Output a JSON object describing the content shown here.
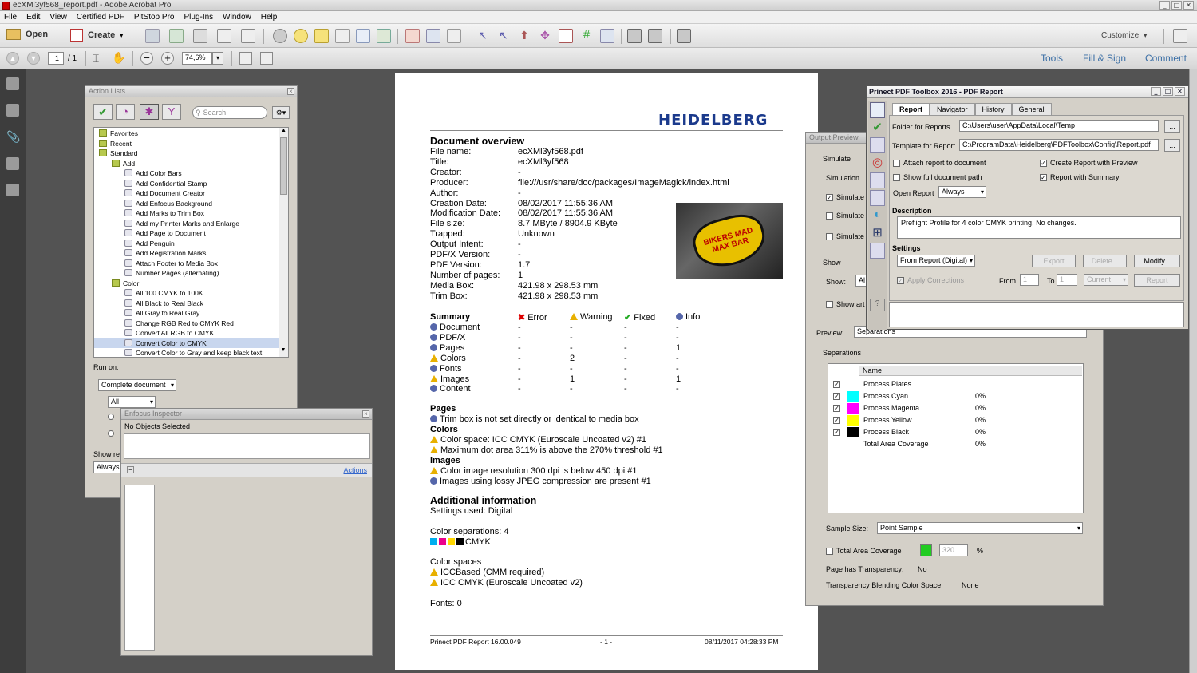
{
  "window": {
    "title": "ecXMl3yf568_report.pdf - Adobe Acrobat Pro"
  },
  "menu": [
    "File",
    "Edit",
    "View",
    "Certified PDF",
    "PitStop Pro",
    "Plug-Ins",
    "Window",
    "Help"
  ],
  "toolbar": {
    "open": "Open",
    "create": "Create",
    "customize": "Customize"
  },
  "nav": {
    "page": "1",
    "pages": "/ 1",
    "zoom": "74,6%",
    "tools": "Tools",
    "fill_sign": "Fill & Sign",
    "comment": "Comment"
  },
  "action_lists": {
    "title": "Action Lists",
    "search_placeholder": "Search",
    "tree": [
      {
        "label": "Favorites",
        "level": 0
      },
      {
        "label": "Recent",
        "level": 0
      },
      {
        "label": "Standard",
        "level": 0
      },
      {
        "label": "Add",
        "level": 1
      },
      {
        "label": "Add Color Bars",
        "level": 2
      },
      {
        "label": "Add Confidential Stamp",
        "level": 2
      },
      {
        "label": "Add Document Creator",
        "level": 2
      },
      {
        "label": "Add Enfocus Background",
        "level": 2
      },
      {
        "label": "Add Marks to Trim Box",
        "level": 2
      },
      {
        "label": "Add my Printer Marks and Enlarge",
        "level": 2
      },
      {
        "label": "Add Page to Document",
        "level": 2
      },
      {
        "label": "Add Penguin",
        "level": 2
      },
      {
        "label": "Add Registration Marks",
        "level": 2
      },
      {
        "label": "Attach Footer to Media Box",
        "level": 2
      },
      {
        "label": "Number Pages  (alternating)",
        "level": 2
      },
      {
        "label": "Color",
        "level": 1
      },
      {
        "label": "All 100 CMYK to 100K",
        "level": 2
      },
      {
        "label": "All Black to Real Black",
        "level": 2
      },
      {
        "label": "All Gray to Real Gray",
        "level": 2
      },
      {
        "label": "Change RGB Red to CMYK Red",
        "level": 2
      },
      {
        "label": "Convert All RGB to CMYK",
        "level": 2
      },
      {
        "label": "Convert Color to CMYK",
        "level": 2
      },
      {
        "label": "Convert Color to Gray and keep black text",
        "level": 2
      }
    ],
    "run_on": "Run on:",
    "run_on_value": "Complete document",
    "all_value": "All",
    "show_res": "Show res",
    "always": "Always"
  },
  "enfocus": {
    "title": "Enfocus Inspector",
    "no_objects": "No Objects Selected",
    "actions": "Actions"
  },
  "report": {
    "logo": "HEIDELBERG",
    "overview_title": "Document overview",
    "fields": [
      {
        "k": "File name:",
        "v": "ecXMl3yf568.pdf"
      },
      {
        "k": "Title:",
        "v": "ecXMl3yf568"
      },
      {
        "k": "Creator:",
        "v": "-"
      },
      {
        "k": "Producer:",
        "v": "file:///usr/share/doc/packages/ImageMagick/index.html"
      },
      {
        "k": "Author:",
        "v": "-"
      },
      {
        "k": "Creation Date:",
        "v": "08/02/2017 11:55:36 AM"
      },
      {
        "k": "Modification Date:",
        "v": "08/02/2017 11:55:36 AM"
      },
      {
        "k": "File size:",
        "v": "8.7 MByte / 8904.9 KByte"
      },
      {
        "k": "Trapped:",
        "v": "Unknown"
      },
      {
        "k": "Output Intent:",
        "v": "-"
      },
      {
        "k": "PDF/X Version:",
        "v": "-"
      },
      {
        "k": "PDF Version:",
        "v": "1.7"
      },
      {
        "k": "Number of pages:",
        "v": "1"
      },
      {
        "k": "Media Box:",
        "v": "421.98 x 298.53 mm"
      },
      {
        "k": "Trim Box:",
        "v": "421.98 x 298.53 mm"
      }
    ],
    "image_text": "BIKERS MAD MAX BAR",
    "summary": {
      "title": "Summary",
      "cols": [
        "Error",
        "Warning",
        "Fixed",
        "Info"
      ],
      "rows": [
        {
          "name": "Document",
          "icon": "info",
          "vals": [
            "-",
            "-",
            "-",
            "-"
          ]
        },
        {
          "name": "PDF/X",
          "icon": "info",
          "vals": [
            "-",
            "-",
            "-",
            "-"
          ]
        },
        {
          "name": "Pages",
          "icon": "info",
          "vals": [
            "-",
            "-",
            "-",
            "1"
          ]
        },
        {
          "name": "Colors",
          "icon": "warn",
          "vals": [
            "-",
            "2",
            "-",
            "-"
          ]
        },
        {
          "name": "Fonts",
          "icon": "info",
          "vals": [
            "-",
            "-",
            "-",
            "-"
          ]
        },
        {
          "name": "Images",
          "icon": "warn",
          "vals": [
            "-",
            "1",
            "-",
            "1"
          ]
        },
        {
          "name": "Content",
          "icon": "info",
          "vals": [
            "-",
            "-",
            "-",
            "-"
          ]
        }
      ]
    },
    "sections": [
      {
        "h": "Pages",
        "items": [
          {
            "icon": "info",
            "t": "Trim box is not set directly or identical to media box"
          }
        ]
      },
      {
        "h": "Colors",
        "items": [
          {
            "icon": "warn",
            "t": "Color space: ICC CMYK (Euroscale Uncoated v2) #1"
          },
          {
            "icon": "warn",
            "t": "Maximum dot area 311% is above the 270% threshold #1"
          }
        ]
      },
      {
        "h": "Images",
        "items": [
          {
            "icon": "warn",
            "t": "Color image resolution 300 dpi is below 450 dpi #1"
          },
          {
            "icon": "info",
            "t": "Images using lossy JPEG compression are present #1"
          }
        ]
      }
    ],
    "additional_title": "Additional information",
    "settings_used": "Settings used: Digital",
    "color_separations": "Color separations: 4",
    "cmyk": "CMYK",
    "color_spaces": "Color spaces",
    "cs_items": [
      "ICCBased (CMM required)",
      "ICC CMYK (Euroscale Uncoated v2)"
    ],
    "fonts": "Fonts: 0",
    "footer_left": "Prinect PDF Report 16.00.049",
    "footer_mid": "- 1 -",
    "footer_right": "08/11/2017 04:28:33 PM"
  },
  "output_preview": {
    "title": "Output Preview",
    "simulate": "Simulate",
    "simulation": "Simulation",
    "simulate_cb": "Simulate",
    "show": "Show",
    "show_label": "Show:",
    "show_value": "Al",
    "show_art": "Show art",
    "preview_label": "Preview:",
    "preview_value": "Separations",
    "separations": "Separations",
    "name_col": "Name",
    "seps": [
      {
        "name": "Process Plates",
        "color": "",
        "pct": ""
      },
      {
        "name": "Process Cyan",
        "color": "#00ffff",
        "pct": "0%"
      },
      {
        "name": "Process Magenta",
        "color": "#ff00ff",
        "pct": "0%"
      },
      {
        "name": "Process Yellow",
        "color": "#ffff00",
        "pct": "0%"
      },
      {
        "name": "Process Black",
        "color": "#000000",
        "pct": "0%"
      },
      {
        "name": "Total Area Coverage",
        "color": "",
        "pct": "0%"
      }
    ],
    "sample_size": "Sample Size:",
    "sample_value": "Point Sample",
    "tac": "Total Area Coverage",
    "tac_value": "320",
    "pct": "%",
    "transparency": "Page has Transparency:",
    "transparency_value": "No",
    "blending": "Transparency Blending Color Space:",
    "blending_value": "None"
  },
  "prinect": {
    "title": "Prinect PDF Toolbox 2016 - PDF Report",
    "tabs": [
      "Report",
      "Navigator",
      "History",
      "General"
    ],
    "folder_label": "Folder for Reports",
    "folder_value": "C:\\Users\\user\\AppData\\Local\\Temp",
    "template_label": "Template for Report",
    "template_value": "C:\\ProgramData\\Heidelberg\\PDFToolbox\\Config\\Report.pdf",
    "attach": "Attach report to document",
    "create_preview": "Create Report with Preview",
    "show_path": "Show full document path",
    "with_summary": "Report with Summary",
    "open_report": "Open Report",
    "open_value": "Always",
    "description": "Description",
    "desc_value": "Preflight Profile for 4 color CMYK printing. No changes.",
    "settings": "Settings",
    "settings_value": "From Report (Digital)",
    "export": "Export",
    "delete": "Delete...",
    "modify": "Modify...",
    "apply": "Apply Corrections",
    "from": "From",
    "from_val": "1",
    "to": "To",
    "to_val": "1",
    "current": "Current",
    "report_btn": "Report",
    "ellipsis": "..."
  }
}
